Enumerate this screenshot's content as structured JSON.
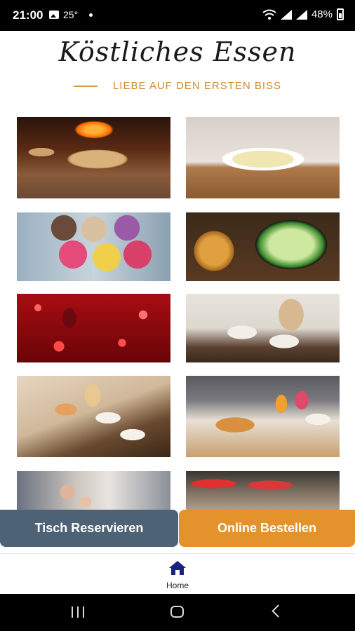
{
  "statusbar": {
    "time": "21:00",
    "temperature": "25°",
    "battery": "48%",
    "icons": [
      "image-icon",
      "wifi-icon",
      "signal-icon",
      "signal-icon",
      "battery-icon"
    ]
  },
  "header": {
    "title": "Köstliches Essen",
    "tagline": "LIEBE AUF DEN ERSTEN BISS",
    "accent_color": "#d08a2c"
  },
  "gallery": {
    "images": [
      "pizza",
      "soup",
      "ice-cream",
      "salad",
      "red-wine",
      "coffee",
      "coffee-and-pastries",
      "breakfast",
      "staff",
      "buffet"
    ]
  },
  "actions": {
    "reserve_label": "Tisch Reservieren",
    "reserve_color": "#4e6276",
    "order_label": "Online Bestellen",
    "order_color": "#e4922c"
  },
  "bottom_nav": {
    "home_label": "Home",
    "home_icon": "house-icon",
    "active_color": "#1a237e"
  },
  "system_nav": {
    "icons": [
      "recent-apps-icon",
      "home-circle-icon",
      "back-icon"
    ]
  }
}
